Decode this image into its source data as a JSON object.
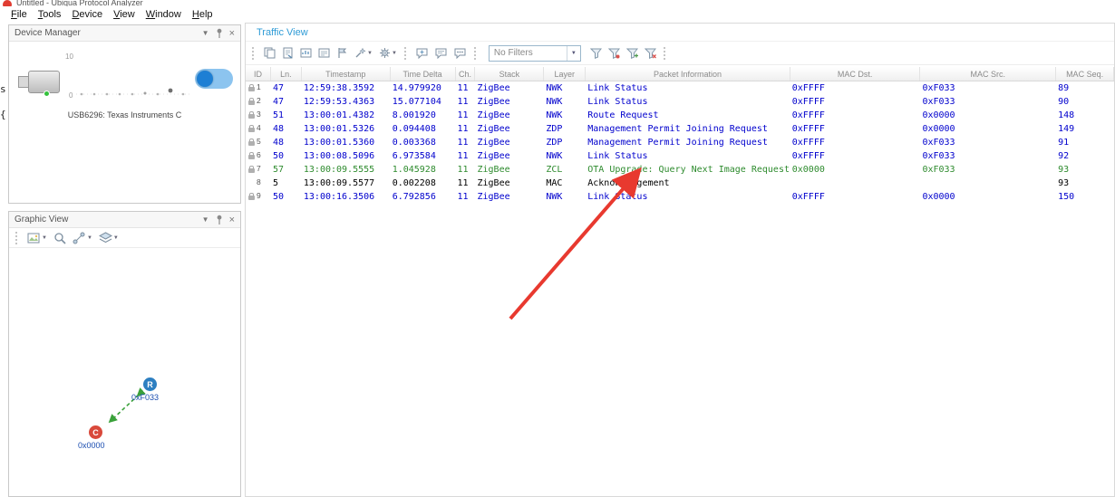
{
  "window": {
    "title": "Untitled - Ubiqua Protocol Analyzer",
    "edge_fragments": [
      "s",
      "{"
    ]
  },
  "menu": {
    "items": [
      "File",
      "Tools",
      "Device",
      "View",
      "Window",
      "Help"
    ]
  },
  "icons": {
    "caret_down": "▼",
    "close": "×"
  },
  "colors": {
    "row_blue": "#0000CD",
    "row_green": "#2E8B2E",
    "row_black": "#000000",
    "annotation_red": "#E8392F",
    "node_router": "#2D7FC1",
    "node_coordinator": "#D9493B",
    "link_green": "#3AA13A",
    "toggle_blue": "#1D7FD4",
    "title_blue": "#2E9BD6"
  },
  "device_manager": {
    "title": "Device Manager",
    "sparkline": {
      "max_label": "10",
      "min_label": "0"
    },
    "device_label": "USB6296: Texas Instruments C",
    "toggle_on": true
  },
  "graphic_view": {
    "title": "Graphic View",
    "nodes": [
      {
        "role": "R",
        "address": "0xF033"
      },
      {
        "role": "C",
        "address": "0x0000"
      }
    ]
  },
  "traffic_view": {
    "title": "Traffic View",
    "filter": {
      "value": "No Filters"
    },
    "columns": [
      "ID",
      "Ln.",
      "Timestamp",
      "Time Delta",
      "Ch.",
      "Stack",
      "Layer",
      "Packet Information",
      "MAC Dst.",
      "MAC Src.",
      "MAC Seq."
    ],
    "rows": [
      {
        "lock": true,
        "id": "1",
        "ln": "47",
        "timestamp": "12:59:38.3592",
        "time_delta": "14.979920",
        "ch": "11",
        "stack": "ZigBee",
        "layer": "NWK",
        "info": "Link Status",
        "mac_dst": "0xFFFF",
        "mac_src": "0xF033",
        "mac_seq": "89",
        "color": "row_blue"
      },
      {
        "lock": true,
        "id": "2",
        "ln": "47",
        "timestamp": "12:59:53.4363",
        "time_delta": "15.077104",
        "ch": "11",
        "stack": "ZigBee",
        "layer": "NWK",
        "info": "Link Status",
        "mac_dst": "0xFFFF",
        "mac_src": "0xF033",
        "mac_seq": "90",
        "color": "row_blue"
      },
      {
        "lock": true,
        "id": "3",
        "ln": "51",
        "timestamp": "13:00:01.4382",
        "time_delta": "8.001920",
        "ch": "11",
        "stack": "ZigBee",
        "layer": "NWK",
        "info": "Route Request",
        "mac_dst": "0xFFFF",
        "mac_src": "0x0000",
        "mac_seq": "148",
        "color": "row_blue"
      },
      {
        "lock": true,
        "id": "4",
        "ln": "48",
        "timestamp": "13:00:01.5326",
        "time_delta": "0.094408",
        "ch": "11",
        "stack": "ZigBee",
        "layer": "ZDP",
        "info": "Management Permit Joining Request",
        "mac_dst": "0xFFFF",
        "mac_src": "0x0000",
        "mac_seq": "149",
        "color": "row_blue"
      },
      {
        "lock": true,
        "id": "5",
        "ln": "48",
        "timestamp": "13:00:01.5360",
        "time_delta": "0.003368",
        "ch": "11",
        "stack": "ZigBee",
        "layer": "ZDP",
        "info": "Management Permit Joining Request",
        "mac_dst": "0xFFFF",
        "mac_src": "0xF033",
        "mac_seq": "91",
        "color": "row_blue"
      },
      {
        "lock": true,
        "id": "6",
        "ln": "50",
        "timestamp": "13:00:08.5096",
        "time_delta": "6.973584",
        "ch": "11",
        "stack": "ZigBee",
        "layer": "NWK",
        "info": "Link Status",
        "mac_dst": "0xFFFF",
        "mac_src": "0xF033",
        "mac_seq": "92",
        "color": "row_blue"
      },
      {
        "lock": true,
        "id": "7",
        "ln": "57",
        "timestamp": "13:00:09.5555",
        "time_delta": "1.045928",
        "ch": "11",
        "stack": "ZigBee",
        "layer": "ZCL",
        "info": "OTA Upgrade: Query Next Image Request",
        "mac_dst": "0x0000",
        "mac_src": "0xF033",
        "mac_seq": "93",
        "color": "row_green"
      },
      {
        "lock": false,
        "id": "8",
        "ln": "5",
        "timestamp": "13:00:09.5577",
        "time_delta": "0.002208",
        "ch": "11",
        "stack": "ZigBee",
        "layer": "MAC",
        "info": "Acknowledgement",
        "mac_dst": "",
        "mac_src": "",
        "mac_seq": "93",
        "color": "row_black"
      },
      {
        "lock": true,
        "id": "9",
        "ln": "50",
        "timestamp": "13:00:16.3506",
        "time_delta": "6.792856",
        "ch": "11",
        "stack": "ZigBee",
        "layer": "NWK",
        "info": "Link Status",
        "mac_dst": "0xFFFF",
        "mac_src": "0x0000",
        "mac_seq": "150",
        "color": "row_blue"
      }
    ]
  }
}
